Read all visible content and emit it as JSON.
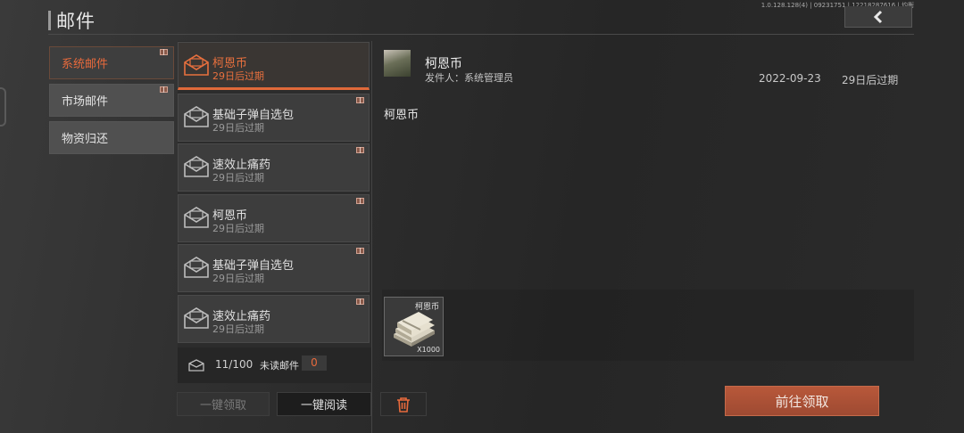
{
  "header": {
    "title": "邮件",
    "version": "1.0.128.128(4) | 09231751 | 12218287616 | 均衡"
  },
  "categories": [
    {
      "label": "系统邮件",
      "active": true,
      "has_gift": true
    },
    {
      "label": "市场邮件",
      "active": false,
      "has_gift": true
    },
    {
      "label": "物资归还",
      "active": false,
      "has_gift": false
    }
  ],
  "mails": [
    {
      "name": "柯恩币",
      "expiry": "29日后过期",
      "selected": true
    },
    {
      "name": "基础子弹自选包",
      "expiry": "29日后过期"
    },
    {
      "name": "速效止痛药",
      "expiry": "29日后过期"
    },
    {
      "name": "柯恩币",
      "expiry": "29日后过期"
    },
    {
      "name": "基础子弹自选包",
      "expiry": "29日后过期"
    },
    {
      "name": "速效止痛药",
      "expiry": "29日后过期"
    }
  ],
  "list_footer": {
    "count": "11/100",
    "unread_label": "未读邮件",
    "unread_count": "0"
  },
  "buttons": {
    "claim_all": "一键领取",
    "read_all": "一键阅读",
    "go_claim": "前往领取"
  },
  "detail": {
    "title": "柯恩币",
    "sender": "发件人：系统管理员",
    "date": "2022-09-23",
    "expiry": "29日后过期",
    "body": "柯恩币",
    "attachment": {
      "name": "柯恩币",
      "quantity": "X1000"
    }
  },
  "colors": {
    "accent": "#e86a3c",
    "claim_button": "#a84f35"
  },
  "icons": {
    "back": "chevron-left-icon",
    "mail": "envelope-icon",
    "gift": "gift-icon",
    "delete": "trash-icon"
  }
}
